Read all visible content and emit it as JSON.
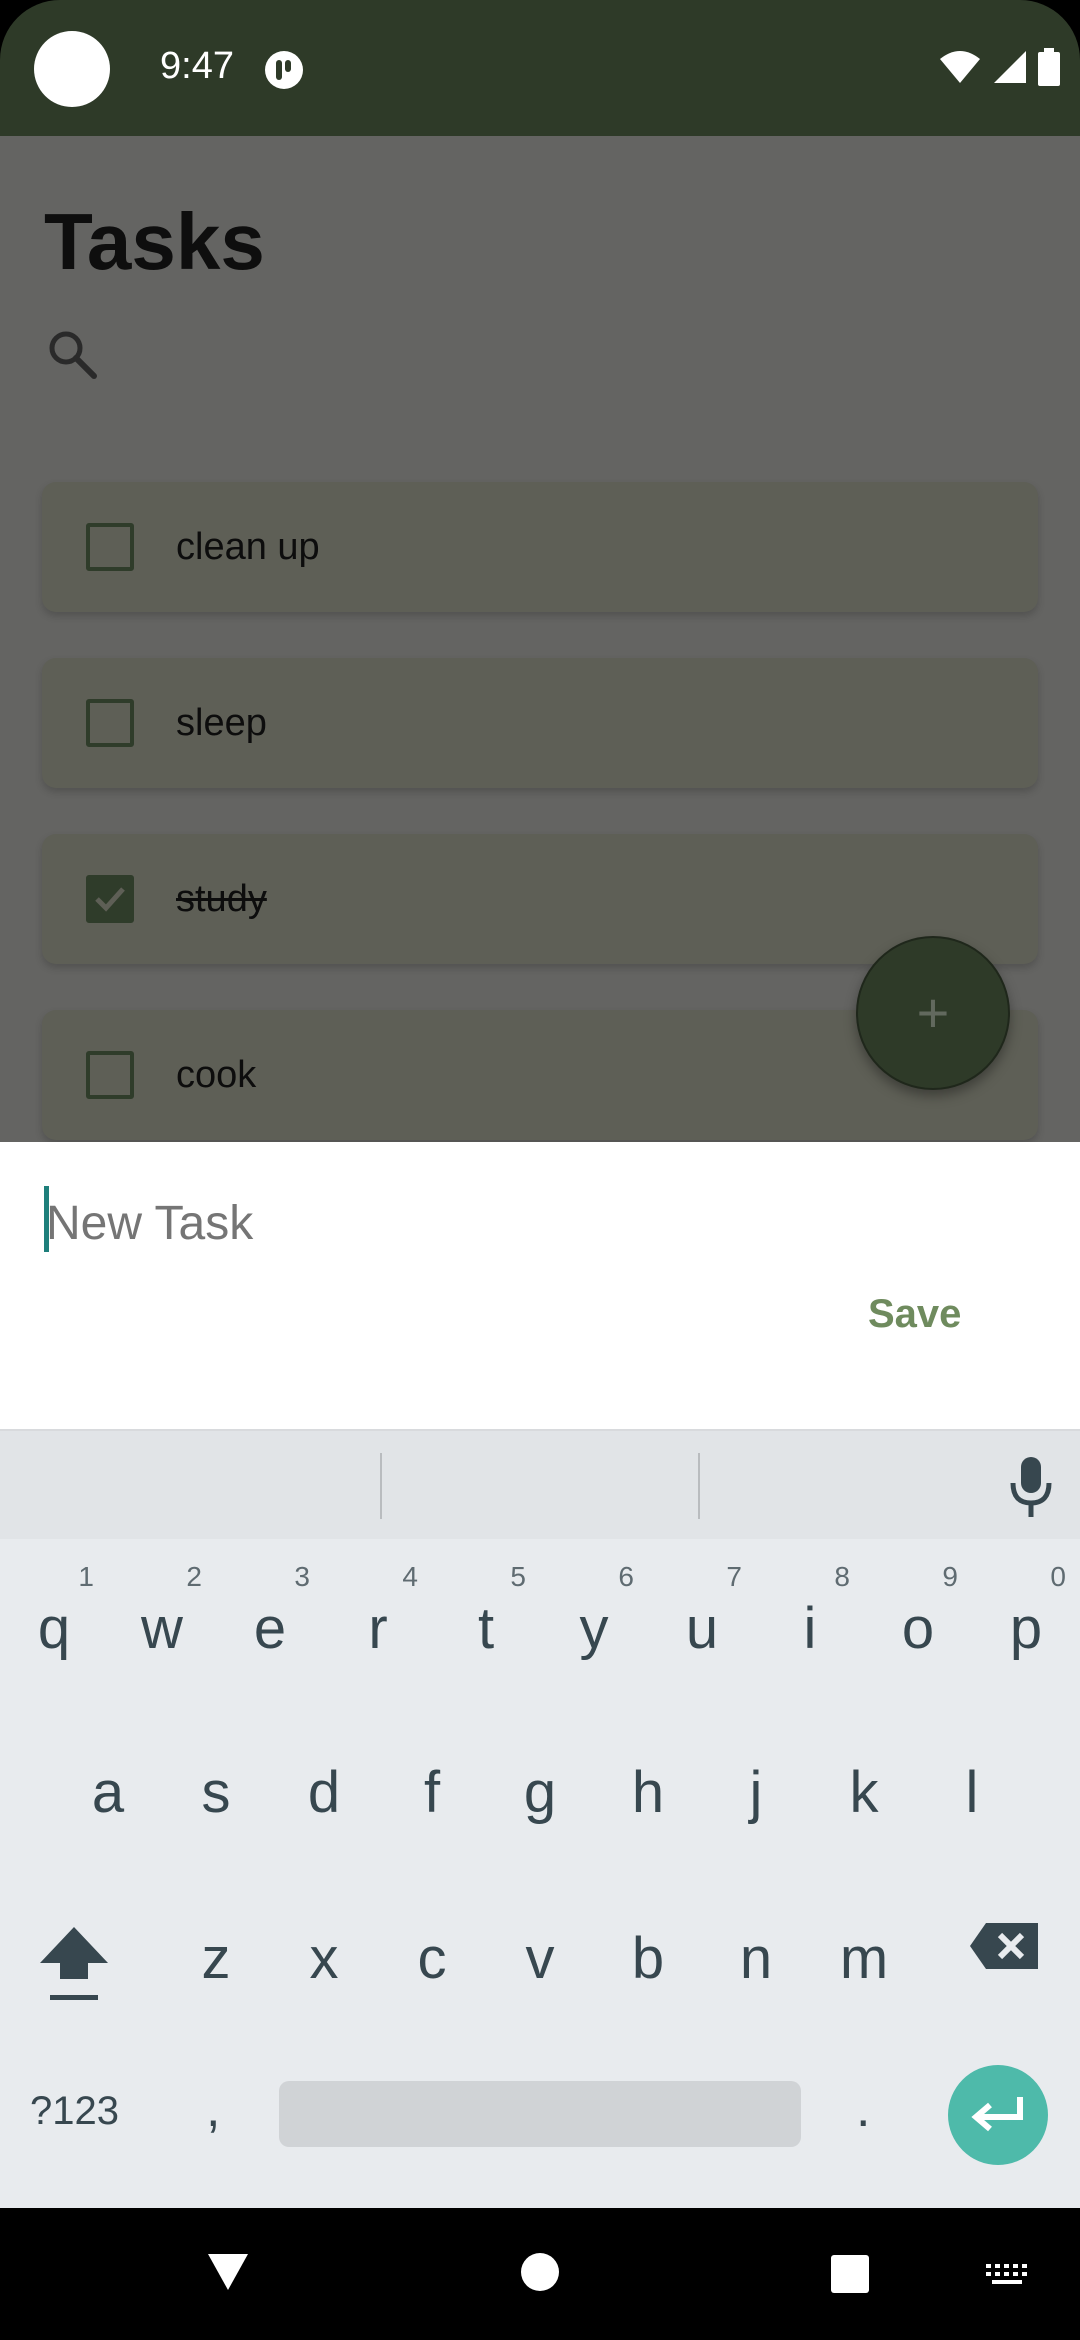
{
  "status_bar": {
    "time": "9:47"
  },
  "app": {
    "title": "Tasks",
    "tasks": [
      {
        "label": "clean up",
        "checked": false
      },
      {
        "label": "sleep",
        "checked": false
      },
      {
        "label": "study",
        "checked": true
      },
      {
        "label": "cook",
        "checked": false
      }
    ],
    "fab_label": "+"
  },
  "sheet": {
    "input_placeholder": "New Task",
    "input_value": "",
    "save_label": "Save"
  },
  "keyboard": {
    "row1": [
      {
        "ch": "q",
        "num": "1"
      },
      {
        "ch": "w",
        "num": "2"
      },
      {
        "ch": "e",
        "num": "3"
      },
      {
        "ch": "r",
        "num": "4"
      },
      {
        "ch": "t",
        "num": "5"
      },
      {
        "ch": "y",
        "num": "6"
      },
      {
        "ch": "u",
        "num": "7"
      },
      {
        "ch": "i",
        "num": "8"
      },
      {
        "ch": "o",
        "num": "9"
      },
      {
        "ch": "p",
        "num": "0"
      }
    ],
    "row2": [
      "a",
      "s",
      "d",
      "f",
      "g",
      "h",
      "j",
      "k",
      "l"
    ],
    "row3": [
      "z",
      "x",
      "c",
      "v",
      "b",
      "n",
      "m"
    ],
    "symbols_label": "?123",
    "comma": ",",
    "period": "."
  },
  "colors": {
    "status_bar": "#2e3a28",
    "accent": "#6f8b5e",
    "enter_key": "#4ebaaa",
    "caret": "#1e7f7b"
  }
}
